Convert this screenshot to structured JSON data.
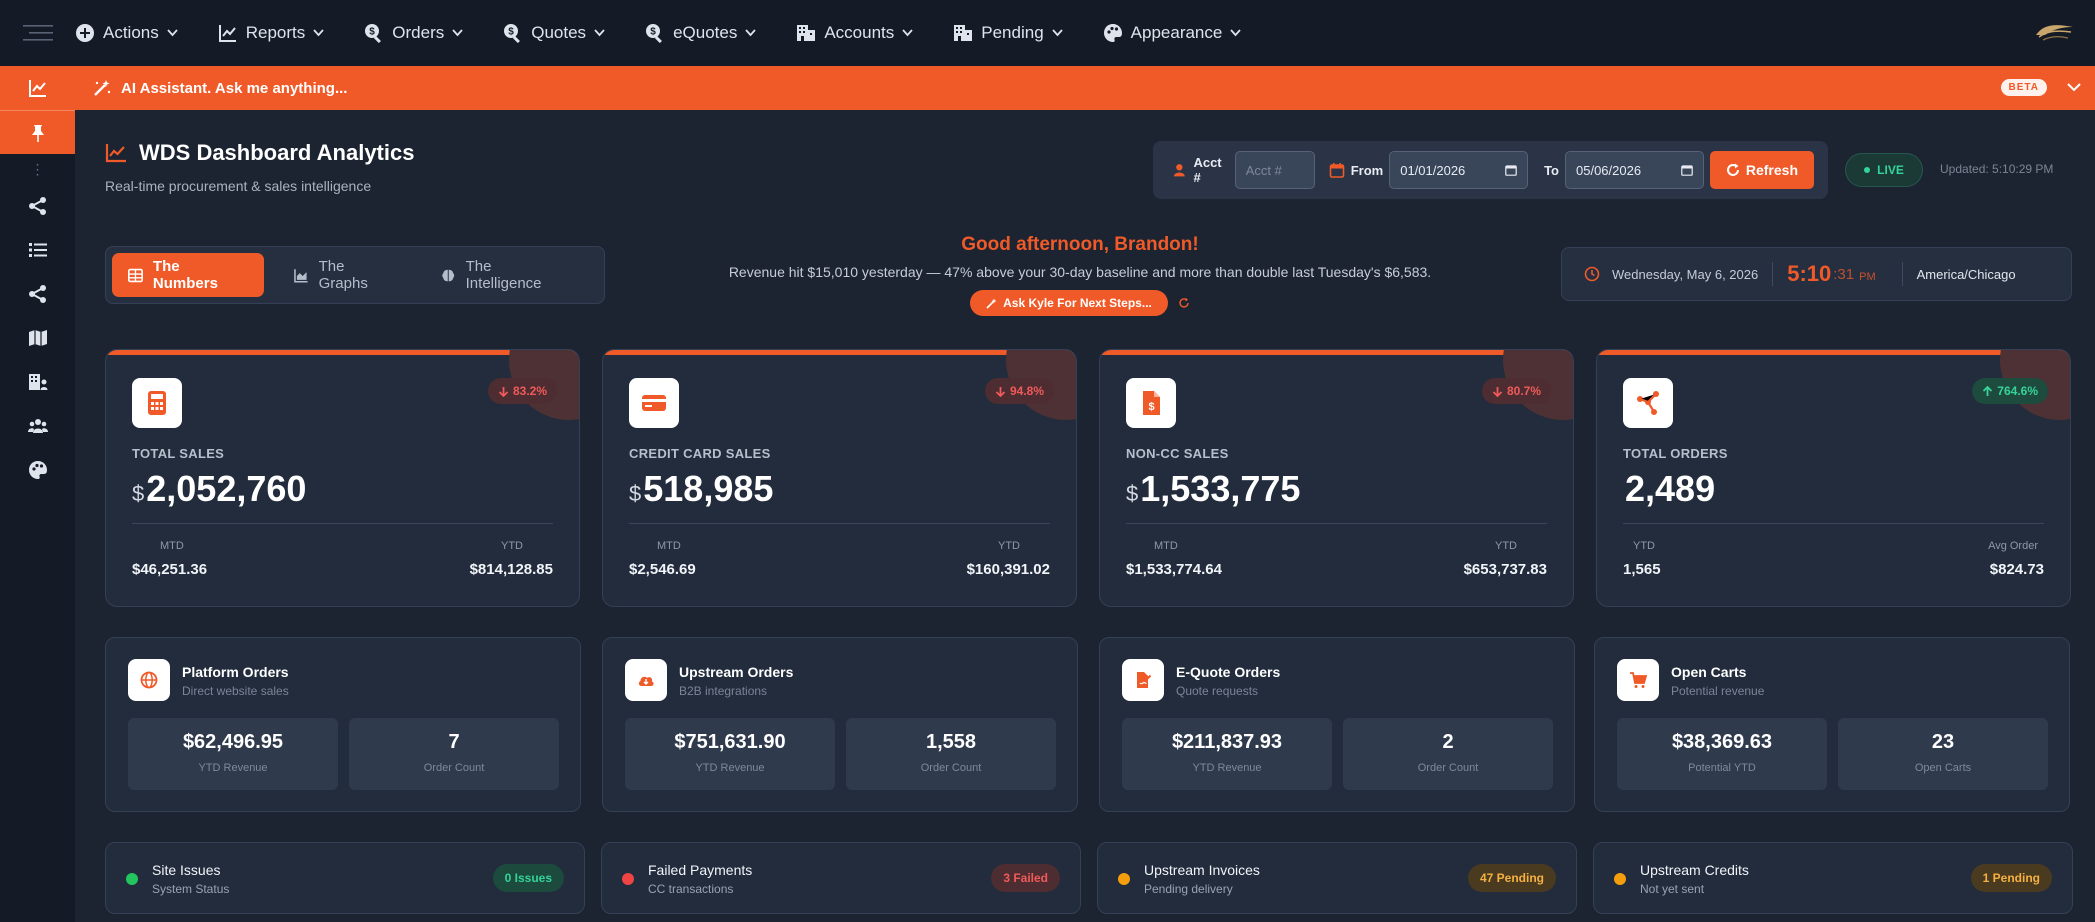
{
  "nav": {
    "items": [
      {
        "label": "Actions",
        "icon": "plus-circle-icon"
      },
      {
        "label": "Reports",
        "icon": "line-chart-icon"
      },
      {
        "label": "Orders",
        "icon": "search-dollar-icon"
      },
      {
        "label": "Quotes",
        "icon": "search-dollar-icon"
      },
      {
        "label": "eQuotes",
        "icon": "search-dollar-icon"
      },
      {
        "label": "Accounts",
        "icon": "building-icon"
      },
      {
        "label": "Pending",
        "icon": "building-icon"
      },
      {
        "label": "Appearance",
        "icon": "palette-icon"
      }
    ]
  },
  "ai_bar": {
    "text": "AI Assistant. Ask me anything...",
    "badge": "BETA"
  },
  "header": {
    "title": "WDS Dashboard Analytics",
    "subtitle": "Real-time procurement & sales intelligence"
  },
  "filters": {
    "acct_label": "Acct #",
    "acct_placeholder": "Acct #",
    "from_label": "From",
    "from_value": "01/01/2026",
    "to_label": "To",
    "to_value": "05/06/2026",
    "refresh_label": "Refresh"
  },
  "live": {
    "label": "LIVE",
    "updated": "Updated: 5:10:29 PM"
  },
  "tabs": [
    {
      "label": "The Numbers",
      "active": true
    },
    {
      "label": "The Graphs",
      "active": false
    },
    {
      "label": "The Intelligence",
      "active": false
    }
  ],
  "greeting": {
    "title": "Good afternoon, Brandon!",
    "text": "Revenue hit $15,010 yesterday — 47% above your 30-day baseline and more than double last Tuesday's $6,583.",
    "button": "Ask Kyle For Next Steps..."
  },
  "clock": {
    "date": "Wednesday, May 6, 2026",
    "time": "5:10",
    "seconds": ":31",
    "ampm": "PM",
    "timezone": "America/Chicago"
  },
  "kpis": [
    {
      "label": "TOTAL SALES",
      "currency": "$",
      "value": "2,052,760",
      "badge": "83.2%",
      "trend": "down",
      "icon": "calculator-icon",
      "left_label": "MTD",
      "left_value": "$46,251.36",
      "right_label": "YTD",
      "right_value": "$814,128.85"
    },
    {
      "label": "CREDIT CARD SALES",
      "currency": "$",
      "value": "518,985",
      "badge": "94.8%",
      "trend": "down",
      "icon": "credit-card-icon",
      "left_label": "MTD",
      "left_value": "$2,546.69",
      "right_label": "YTD",
      "right_value": "$160,391.02"
    },
    {
      "label": "NON-CC SALES",
      "currency": "$",
      "value": "1,533,775",
      "badge": "80.7%",
      "trend": "down",
      "icon": "invoice-dollar-icon",
      "left_label": "MTD",
      "left_value": "$1,533,774.64",
      "right_label": "YTD",
      "right_value": "$653,737.83"
    },
    {
      "label": "TOTAL ORDERS",
      "currency": "",
      "value": "2,489",
      "badge": "764.6%",
      "trend": "up",
      "icon": "network-icon",
      "left_label": "YTD",
      "left_value": "1,565",
      "right_label": "Avg Order",
      "right_value": "$824.73"
    }
  ],
  "orders": [
    {
      "title": "Platform Orders",
      "sub": "Direct website sales",
      "icon": "globe-icon",
      "v1": "$62,496.95",
      "l1": "YTD Revenue",
      "v2": "7",
      "l2": "Order Count"
    },
    {
      "title": "Upstream Orders",
      "sub": "B2B integrations",
      "icon": "cloud-download-icon",
      "v1": "$751,631.90",
      "l1": "YTD Revenue",
      "v2": "1,558",
      "l2": "Order Count"
    },
    {
      "title": "E-Quote Orders",
      "sub": "Quote requests",
      "icon": "file-signature-icon",
      "v1": "$211,837.93",
      "l1": "YTD Revenue",
      "v2": "2",
      "l2": "Order Count"
    },
    {
      "title": "Open Carts",
      "sub": "Potential revenue",
      "icon": "cart-icon",
      "v1": "$38,369.63",
      "l1": "Potential YTD",
      "v2": "23",
      "l2": "Open Carts"
    }
  ],
  "statuses": [
    {
      "title": "Site Issues",
      "sub": "System Status",
      "badge": "0 Issues",
      "color": "#22c55e",
      "badge_bg": "#1c4a3c",
      "badge_fg": "#34d399"
    },
    {
      "title": "Failed Payments",
      "sub": "CC transactions",
      "badge": "3 Failed",
      "color": "#ef4444",
      "badge_bg": "#4d2d31",
      "badge_fg": "#f05a5a"
    },
    {
      "title": "Upstream Invoices",
      "sub": "Pending delivery",
      "badge": "47 Pending",
      "color": "#f59e0b",
      "badge_bg": "#4a3a1f",
      "badge_fg": "#f5b041"
    },
    {
      "title": "Upstream Credits",
      "sub": "Not yet sent",
      "badge": "1 Pending",
      "color": "#f59e0b",
      "badge_bg": "#4a3a1f",
      "badge_fg": "#f5b041"
    }
  ],
  "colors": {
    "accent": "#f05a28",
    "bg": "#1c2431",
    "card": "#222c3c"
  }
}
